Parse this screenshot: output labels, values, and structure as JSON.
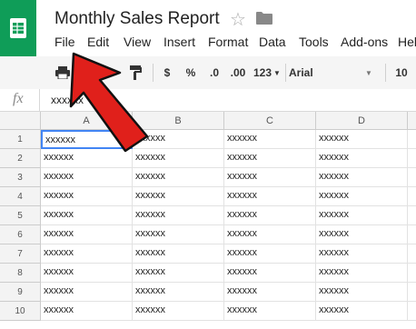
{
  "app": {
    "title": "Monthly Sales Report",
    "logo_icon": "sheets-logo-icon",
    "accent_color": "#0f9d58"
  },
  "menu": [
    "File",
    "Edit",
    "View",
    "Insert",
    "Format",
    "Data",
    "Tools",
    "Add-ons",
    "Hel"
  ],
  "toolbar": {
    "print_icon": "print-icon",
    "paint_format_icon": "paint-format-icon",
    "currency_label": "$",
    "percent_label": "%",
    "decrease_decimal_label": ".0",
    "increase_decimal_label": ".00",
    "more_formats_label": "123",
    "font_name": "Arial",
    "font_size": "10"
  },
  "formula_bar": {
    "fx_label": "fx",
    "value": "xxxxxx"
  },
  "columns": [
    "A",
    "B",
    "C",
    "D"
  ],
  "rows": [
    {
      "num": "1",
      "cells": [
        "xxxxxx",
        "xxxxxx",
        "xxxxxx",
        "xxxxxx"
      ]
    },
    {
      "num": "2",
      "cells": [
        "xxxxxx",
        "xxxxxx",
        "xxxxxx",
        "xxxxxx"
      ]
    },
    {
      "num": "3",
      "cells": [
        "xxxxxx",
        "xxxxxx",
        "xxxxxx",
        "xxxxxx"
      ]
    },
    {
      "num": "4",
      "cells": [
        "xxxxxx",
        "xxxxxx",
        "xxxxxx",
        "xxxxxx"
      ]
    },
    {
      "num": "5",
      "cells": [
        "xxxxxx",
        "xxxxxx",
        "xxxxxx",
        "xxxxxx"
      ]
    },
    {
      "num": "6",
      "cells": [
        "xxxxxx",
        "xxxxxx",
        "xxxxxx",
        "xxxxxx"
      ]
    },
    {
      "num": "7",
      "cells": [
        "xxxxxx",
        "xxxxxx",
        "xxxxxx",
        "xxxxxx"
      ]
    },
    {
      "num": "8",
      "cells": [
        "xxxxxx",
        "xxxxxx",
        "xxxxxx",
        "xxxxxx"
      ]
    },
    {
      "num": "9",
      "cells": [
        "xxxxxx",
        "xxxxxx",
        "xxxxxx",
        "xxxxxx"
      ]
    },
    {
      "num": "10",
      "cells": [
        "xxxxxx",
        "xxxxxx",
        "xxxxxx",
        "xxxxxx"
      ]
    }
  ],
  "annotation": {
    "icon": "red-arrow-icon",
    "color": "#e0201b"
  }
}
